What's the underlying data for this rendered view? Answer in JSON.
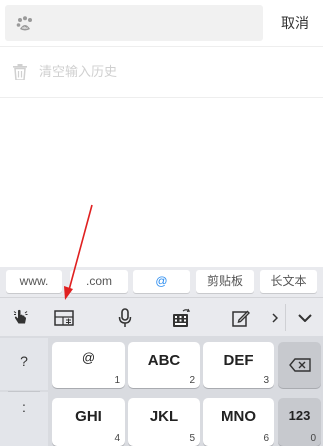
{
  "search": {
    "cancel_label": "取消",
    "placeholder": ""
  },
  "history": {
    "clear_label": "清空输入历史"
  },
  "quick_inputs": [
    "www.",
    ".com",
    "@",
    "剪贴板",
    "长文本"
  ],
  "keyboard": {
    "side_keys": [
      "?",
      ":"
    ],
    "keys": [
      {
        "main": "@",
        "sub": "1"
      },
      {
        "main": "ABC",
        "sub": "2"
      },
      {
        "main": "DEF",
        "sub": "3"
      },
      {
        "main": "GHI",
        "sub": "4"
      },
      {
        "main": "JKL",
        "sub": "5"
      },
      {
        "main": "MNO",
        "sub": "6"
      }
    ],
    "num_key": "123",
    "num_key_sub": "0"
  },
  "colors": {
    "accent": "#2a8cf0",
    "annotation_arrow": "#e02020"
  }
}
